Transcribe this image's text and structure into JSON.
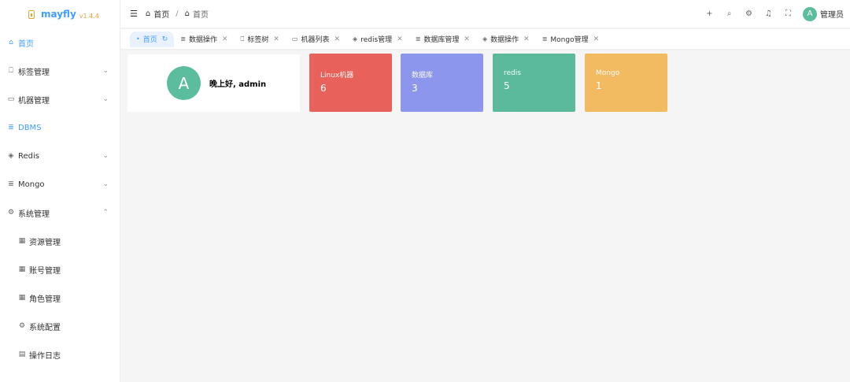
{
  "app": {
    "name": "mayfly",
    "version": "v1.4.4"
  },
  "sidebar": {
    "items": [
      {
        "label": "首页",
        "icon": "home-icon",
        "glyph": "⌂",
        "active": true,
        "arrow": ""
      },
      {
        "label": "标签管理",
        "icon": "bookmark-icon",
        "glyph": "⎕",
        "active": false,
        "arrow": "⌄"
      },
      {
        "label": "机器管理",
        "icon": "monitor-icon",
        "glyph": "▭",
        "active": false,
        "arrow": "⌄"
      },
      {
        "label": "DBMS",
        "icon": "database-icon",
        "glyph": "≣",
        "active": true,
        "arrow": ""
      },
      {
        "label": "Redis",
        "icon": "layers-icon",
        "glyph": "◈",
        "active": false,
        "arrow": "⌄"
      },
      {
        "label": "Mongo",
        "icon": "database-icon",
        "glyph": "≣",
        "active": false,
        "arrow": "⌄"
      },
      {
        "label": "系统管理",
        "icon": "gear-icon",
        "glyph": "⚙",
        "active": false,
        "arrow": "⌃"
      }
    ],
    "submenu": [
      {
        "label": "资源管理",
        "icon": "grid-icon",
        "glyph": "▦"
      },
      {
        "label": "账号管理",
        "icon": "grid-icon",
        "glyph": "▦"
      },
      {
        "label": "角色管理",
        "icon": "grid-icon",
        "glyph": "▦"
      },
      {
        "label": "系统配置",
        "icon": "gear-icon",
        "glyph": "⚙"
      },
      {
        "label": "操作日志",
        "icon": "document-icon",
        "glyph": "▤"
      }
    ]
  },
  "header": {
    "menu_icon": "☰",
    "breadcrumb": [
      "首页",
      "首页"
    ],
    "separator": "/",
    "home_glyph": "⌂",
    "icons": [
      {
        "name": "plus-icon",
        "glyph": "+"
      },
      {
        "name": "search-icon",
        "glyph": "⌕"
      },
      {
        "name": "settings-icon",
        "glyph": "⚙"
      },
      {
        "name": "bell-icon",
        "glyph": "♫"
      },
      {
        "name": "fullscreen-icon",
        "glyph": "⛶"
      }
    ],
    "avatar_letter": "A",
    "username": "管理员"
  },
  "tabs": [
    {
      "label": "首页",
      "icon": "dot-icon",
      "glyph": "•",
      "active": true,
      "suffix": "↻"
    },
    {
      "label": "数据操作",
      "icon": "database-icon",
      "glyph": "≣",
      "active": false,
      "suffix": "✕"
    },
    {
      "label": "标签树",
      "icon": "bookmark-icon",
      "glyph": "⎕",
      "active": false,
      "suffix": "✕"
    },
    {
      "label": "机器列表",
      "icon": "monitor-icon",
      "glyph": "▭",
      "active": false,
      "suffix": "✕"
    },
    {
      "label": "redis管理",
      "icon": "layers-icon",
      "glyph": "◈",
      "active": false,
      "suffix": "✕"
    },
    {
      "label": "数据库管理",
      "icon": "database-icon",
      "glyph": "≣",
      "active": false,
      "suffix": "✕"
    },
    {
      "label": "数据操作",
      "icon": "layers-icon",
      "glyph": "◈",
      "active": false,
      "suffix": "✕"
    },
    {
      "label": "Mongo管理",
      "icon": "database-icon",
      "glyph": "≣",
      "active": false,
      "suffix": "✕"
    }
  ],
  "welcome": {
    "avatar_letter": "A",
    "greeting": "晚上好, admin"
  },
  "cards": [
    {
      "label": "Linux机器",
      "value": "6",
      "color": "#e8625b"
    },
    {
      "label": "数据库",
      "value": "3",
      "color": "#8c96ec"
    },
    {
      "label": "redis",
      "value": "5",
      "color": "#5bba9b"
    },
    {
      "label": "Mongo",
      "value": "1",
      "color": "#f2bb61"
    }
  ]
}
